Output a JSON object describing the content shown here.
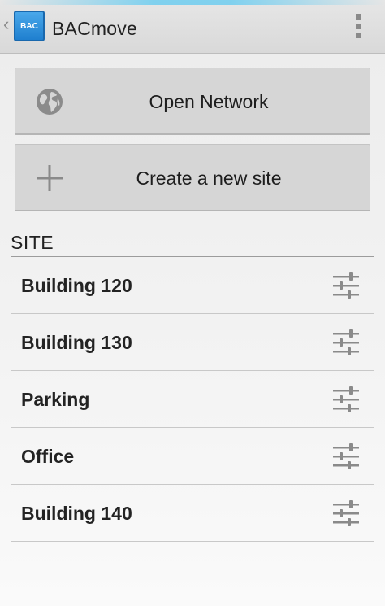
{
  "action_bar": {
    "app_icon_text": "BAC",
    "title": "BACmove",
    "up_icon": "chevron-left-icon",
    "menu_icon": "overflow-menu-icon"
  },
  "buttons": {
    "open_network": {
      "label": "Open Network",
      "icon": "globe-icon"
    },
    "create_site": {
      "label": "Create a new site",
      "icon": "plus-icon"
    }
  },
  "section": {
    "header": "SITE"
  },
  "sites": [
    {
      "name": "Building 120",
      "icon": "settings-sliders-icon"
    },
    {
      "name": "Building 130",
      "icon": "settings-sliders-icon"
    },
    {
      "name": "Parking",
      "icon": "settings-sliders-icon"
    },
    {
      "name": "Office",
      "icon": "settings-sliders-icon"
    },
    {
      "name": "Building 140",
      "icon": "settings-sliders-icon"
    }
  ],
  "colors": {
    "accent_glow": "#6ecdf0",
    "app_icon_blue": "#2f90dc",
    "button_bg": "#d6d6d6",
    "icon_gray": "#8a8a8a"
  }
}
